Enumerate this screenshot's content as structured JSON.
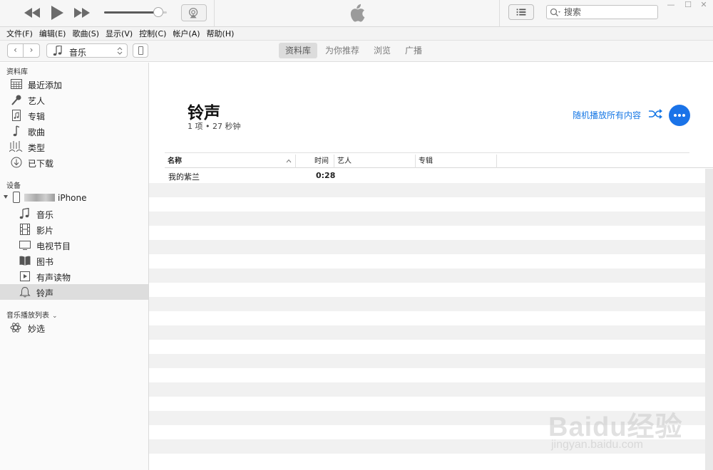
{
  "search": {
    "placeholder": "搜索"
  },
  "menu": [
    "文件(F)",
    "编辑(E)",
    "歌曲(S)",
    "显示(V)",
    "控制(C)",
    "帐户(A)",
    "帮助(H)"
  ],
  "nav": {
    "media_kind": "音乐",
    "tabs": [
      "资料库",
      "为你推荐",
      "浏览",
      "广播"
    ],
    "active_tab": "资料库"
  },
  "sidebar": {
    "library_title": "资料库",
    "library": [
      {
        "label": "最近添加",
        "icon": "grid-icon"
      },
      {
        "label": "艺人",
        "icon": "microphone-icon"
      },
      {
        "label": "专辑",
        "icon": "album-icon"
      },
      {
        "label": "歌曲",
        "icon": "music-note-icon"
      },
      {
        "label": "类型",
        "icon": "genre-icon"
      },
      {
        "label": "已下载",
        "icon": "download-icon"
      }
    ],
    "devices_title": "设备",
    "device_name": "iPhone",
    "device_items": [
      {
        "label": "音乐",
        "icon": "music-note-icon"
      },
      {
        "label": "影片",
        "icon": "film-icon"
      },
      {
        "label": "电视节目",
        "icon": "tv-icon"
      },
      {
        "label": "图书",
        "icon": "book-icon"
      },
      {
        "label": "有声读物",
        "icon": "audiobook-icon"
      },
      {
        "label": "铃声",
        "icon": "bell-icon"
      }
    ],
    "selected_device_item": "铃声",
    "playlists_title": "音乐播放列表",
    "playlists": [
      {
        "label": "妙选",
        "icon": "atom-icon"
      }
    ]
  },
  "main": {
    "title": "铃声",
    "subtitle": "1 项 • 27 秒钟",
    "shuffle_label": "随机播放所有内容",
    "columns": [
      "名称",
      "时间",
      "艺人",
      "专辑"
    ],
    "rows": [
      {
        "name": "我的紫兰",
        "time": "0:28",
        "artist": "",
        "album": ""
      }
    ]
  },
  "player": {
    "volume": 0.86
  },
  "watermark": {
    "text": "Baidu经验",
    "url": "jingyan.baidu.com"
  },
  "colors": {
    "accent": "#1a73e8",
    "link": "#1677e5",
    "selected": "#dddddd",
    "stripe": "#f1f1f1"
  }
}
